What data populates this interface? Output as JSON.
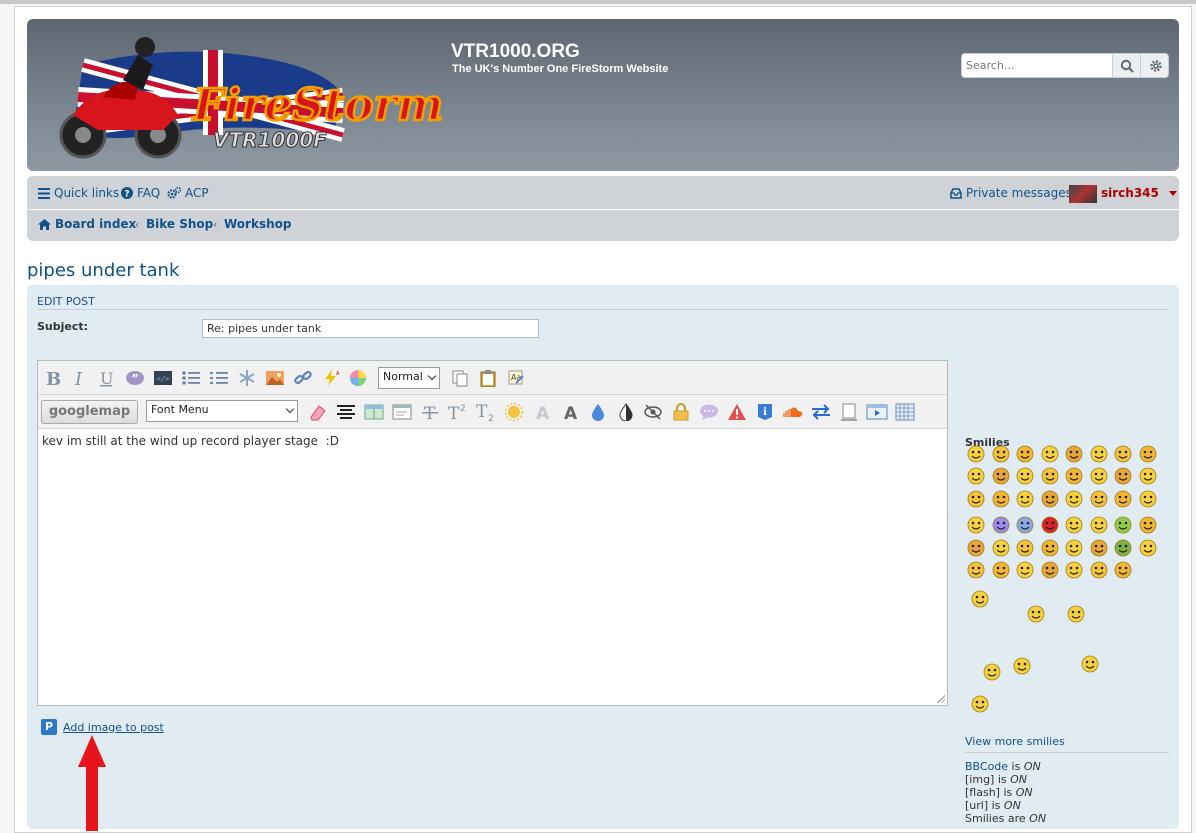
{
  "site": {
    "title": "VTR1000.ORG",
    "description": "The UK's Number One FireStorm Website",
    "logo_text": "FireStorm",
    "logo_subtext": "VTR1000F"
  },
  "search": {
    "placeholder": "Search…",
    "search_icon": "search-icon",
    "advanced_icon": "gear-icon"
  },
  "nav": {
    "quick_links": "Quick links",
    "faq": "FAQ",
    "acp": "ACP",
    "private_messages": "Private messages",
    "username": "sirch345"
  },
  "breadcrumbs": [
    "Board index",
    "Bike Shop",
    "Workshop"
  ],
  "page": {
    "title": "pipes under tank"
  },
  "editor": {
    "heading": "EDIT POST",
    "subject_label": "Subject:",
    "subject_value": "Re: pipes under tank",
    "font_size_select": "Normal",
    "font_menu_select": "Font Menu",
    "googlemap_button": "googlemap",
    "message": "kev im still at the wind up record player stage  :D",
    "add_image_link": "Add image to post"
  },
  "smilies": {
    "title": "Smilies",
    "view_more": "View more smilies"
  },
  "options": {
    "bbcode_link": "BBCode",
    "bbcode_suffix": " is ",
    "bbcode_state": "ON",
    "img_label": "[img] is ",
    "img_state": "ON",
    "flash_label": "[flash] is ",
    "flash_state": "ON",
    "url_label": "[url] is ",
    "url_state": "ON",
    "smilies_label": "Smilies are ",
    "smilies_state": "ON"
  },
  "colors": {
    "header_bg": "#6b757f",
    "link": "#105289",
    "username": "#aa0000",
    "panel_bg": "#e1ebf2",
    "arrow": "#e8141c"
  }
}
